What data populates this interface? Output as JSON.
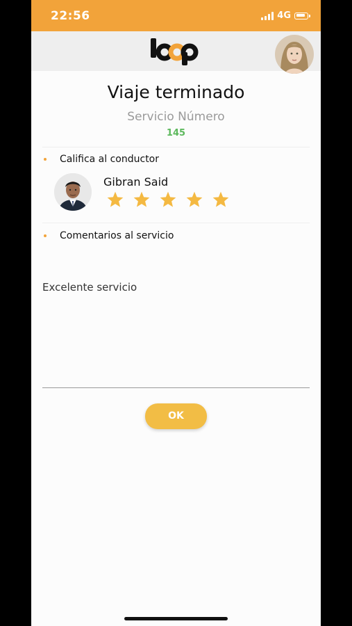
{
  "status_bar": {
    "time": "22:56",
    "network": "4G"
  },
  "header": {
    "logo_text": "loop",
    "logo_colors": {
      "dark": "#111111",
      "accent": "#f2a33a"
    }
  },
  "trip": {
    "title": "Viaje terminado",
    "subtitle": "Servicio Número",
    "service_number": "145"
  },
  "rating": {
    "label": "Califica al conductor",
    "driver_name": "Gibran Said",
    "stars": 5,
    "max_stars": 5
  },
  "comments": {
    "label": "Comentarios al servicio",
    "value": "Excelente servicio"
  },
  "actions": {
    "ok_label": "OK"
  },
  "colors": {
    "status_bar": "#f2a33a",
    "star": "#f4b942",
    "button": "#f2bd45",
    "service_number": "#5cb85c"
  }
}
